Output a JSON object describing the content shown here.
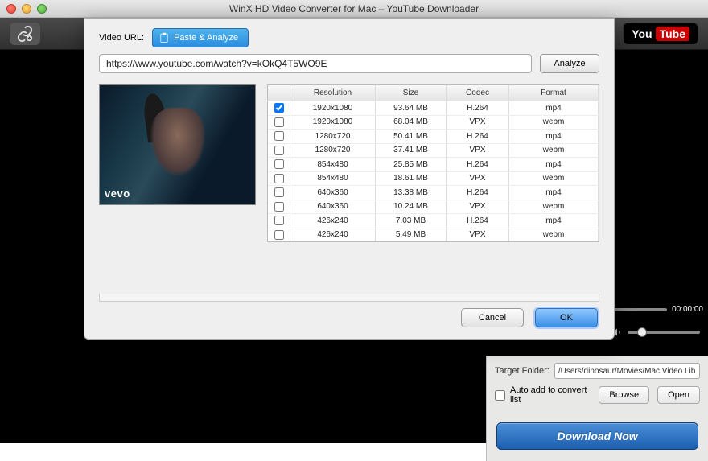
{
  "window": {
    "title": "WinX HD Video Converter for Mac – YouTube Downloader"
  },
  "toolbar": {
    "youtube_you": "You",
    "youtube_tube": "Tube"
  },
  "dialog": {
    "url_label": "Video URL:",
    "paste_label": "Paste & Analyze",
    "url_value": "https://www.youtube.com/watch?v=kOkQ4T5WO9E",
    "analyze_label": "Analyze",
    "cancel_label": "Cancel",
    "ok_label": "OK",
    "thumb_badge": "vevo"
  },
  "table": {
    "headers": {
      "resolution": "Resolution",
      "size": "Size",
      "codec": "Codec",
      "format": "Format"
    },
    "rows": [
      {
        "checked": true,
        "resolution": "1920x1080",
        "size": "93.64 MB",
        "codec": "H.264",
        "format": "mp4"
      },
      {
        "checked": false,
        "resolution": "1920x1080",
        "size": "68.04 MB",
        "codec": "VPX",
        "format": "webm"
      },
      {
        "checked": false,
        "resolution": "1280x720",
        "size": "50.41 MB",
        "codec": "H.264",
        "format": "mp4"
      },
      {
        "checked": false,
        "resolution": "1280x720",
        "size": "37.41 MB",
        "codec": "VPX",
        "format": "webm"
      },
      {
        "checked": false,
        "resolution": "854x480",
        "size": "25.85 MB",
        "codec": "H.264",
        "format": "mp4"
      },
      {
        "checked": false,
        "resolution": "854x480",
        "size": "18.61 MB",
        "codec": "VPX",
        "format": "webm"
      },
      {
        "checked": false,
        "resolution": "640x360",
        "size": "13.38 MB",
        "codec": "H.264",
        "format": "mp4"
      },
      {
        "checked": false,
        "resolution": "640x360",
        "size": "10.24 MB",
        "codec": "VPX",
        "format": "webm"
      },
      {
        "checked": false,
        "resolution": "426x240",
        "size": "7.03 MB",
        "codec": "H.264",
        "format": "mp4"
      },
      {
        "checked": false,
        "resolution": "426x240",
        "size": "5.49 MB",
        "codec": "VPX",
        "format": "webm"
      }
    ]
  },
  "player": {
    "time": "00:00:00"
  },
  "side": {
    "target_label": "Target Folder:",
    "target_value": "/Users/dinosaur/Movies/Mac Video Library",
    "auto_add_label": "Auto add to convert list",
    "browse_label": "Browse",
    "open_label": "Open",
    "download_label": "Download Now"
  }
}
